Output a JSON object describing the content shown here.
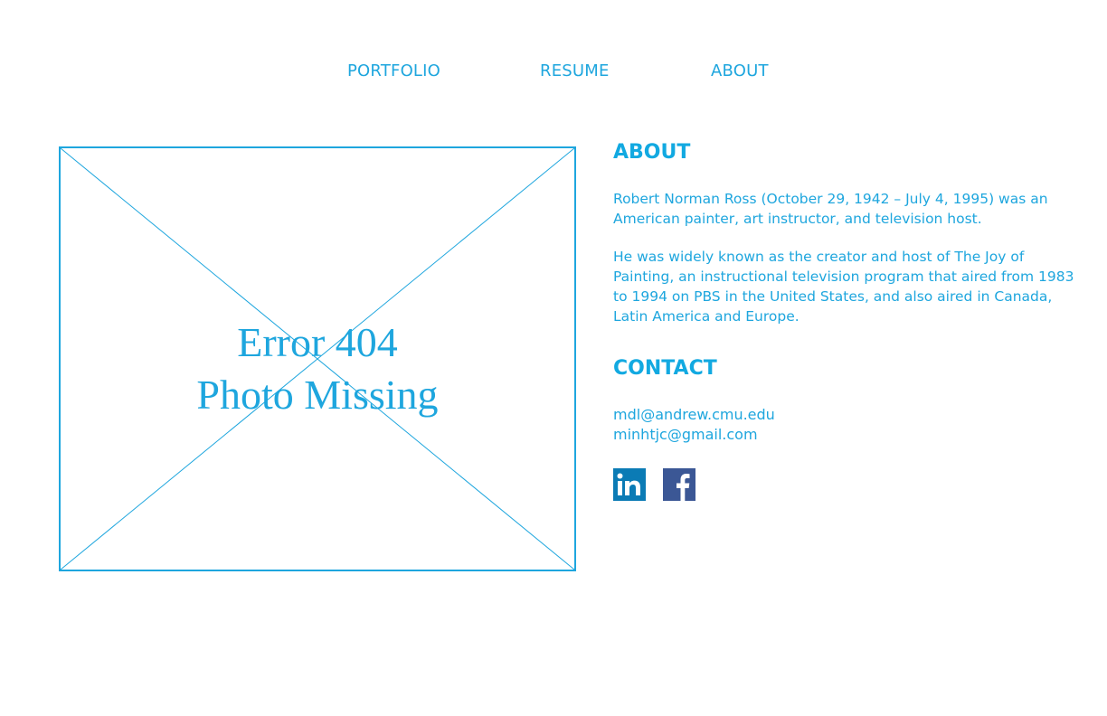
{
  "nav": {
    "items": [
      {
        "label": "PORTFOLIO"
      },
      {
        "label": "RESUME"
      },
      {
        "label": "ABOUT"
      }
    ]
  },
  "photo": {
    "line1": "Error 404",
    "line2": "Photo Missing"
  },
  "about": {
    "heading": "ABOUT",
    "paragraph1": "Robert Norman Ross (October 29, 1942 – July 4, 1995) was an American painter, art instructor, and television host.",
    "paragraph2": "He was widely known as the creator and host of The Joy of Painting, an instructional television program that aired from 1983 to 1994 on PBS in the United States, and also aired in Canada, Latin America and Europe."
  },
  "contact": {
    "heading": "CONTACT",
    "emails": [
      "mdl@andrew.cmu.edu",
      "minhtjc@gmail.com"
    ]
  },
  "social": [
    {
      "icon": "linkedin-icon",
      "color": "#0b7bb5"
    },
    {
      "icon": "facebook-icon",
      "color": "#3b5795"
    }
  ],
  "colors": {
    "accent": "#1ea6de"
  }
}
